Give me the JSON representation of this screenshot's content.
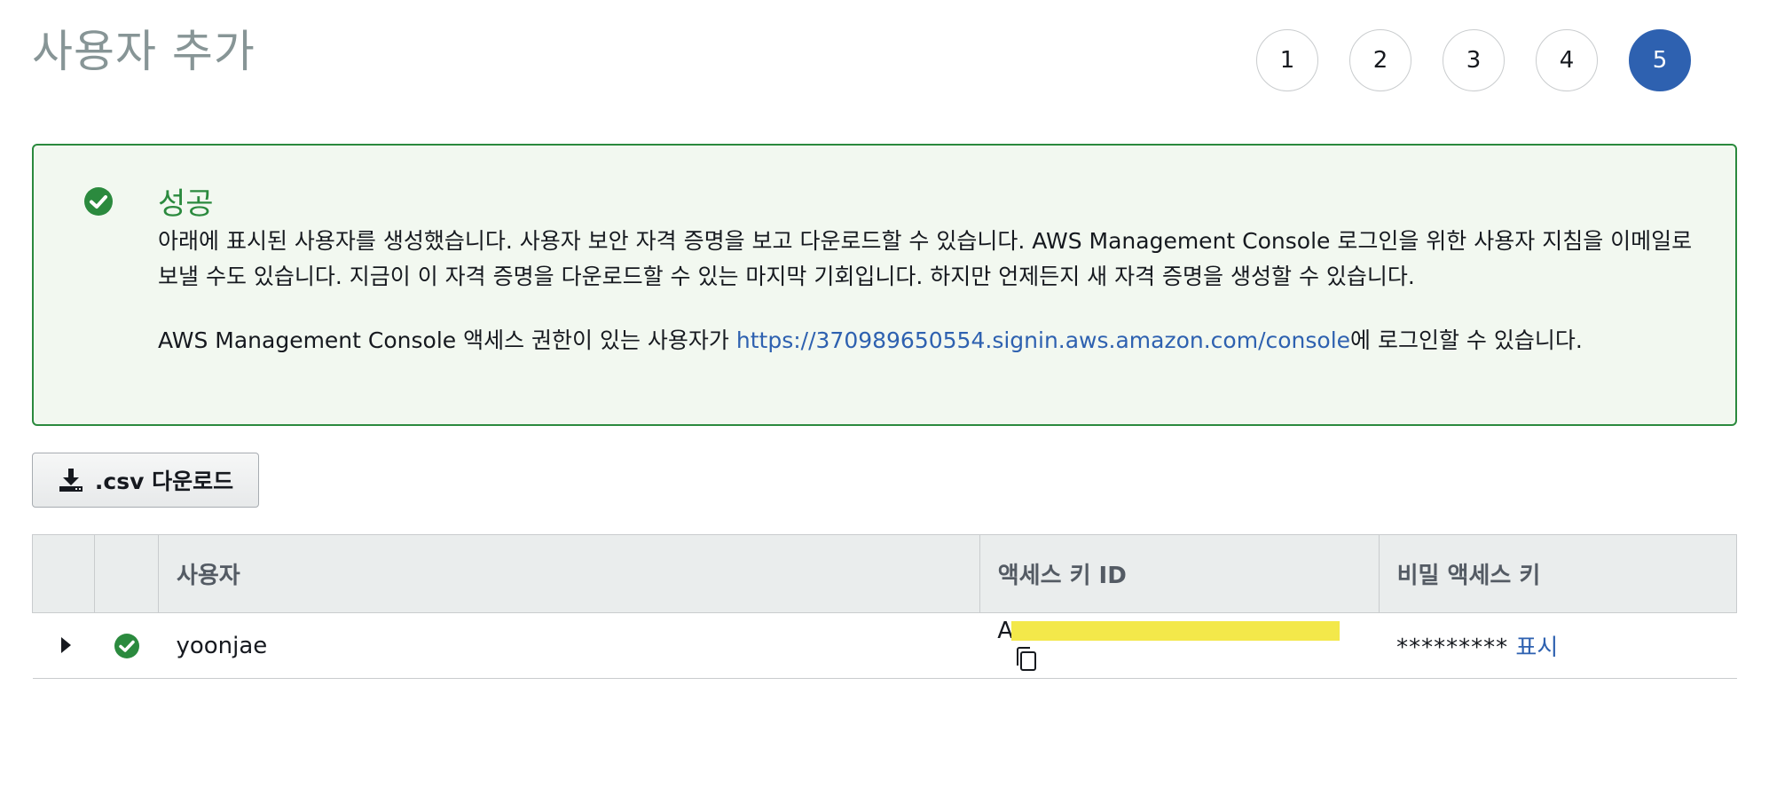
{
  "page": {
    "title": "사용자 추가"
  },
  "steps": [
    "1",
    "2",
    "3",
    "4",
    "5"
  ],
  "active_step": "5",
  "success": {
    "title": "성공",
    "description": "아래에 표시된 사용자를 생성했습니다. 사용자 보안 자격 증명을 보고 다운로드할 수 있습니다. AWS Management Console 로그인을 위한 사용자 지침을 이메일로 보낼 수도 있습니다. 지금이 이 자격 증명을 다운로드할 수 있는 마지막 기회입니다. 하지만 언제든지 새 자격 증명을 생성할 수 있습니다.",
    "login_prefix": "AWS Management Console 액세스 권한이 있는 사용자가 ",
    "login_url": "https://370989650554.signin.aws.amazon.com/console",
    "login_suffix": "에 로그인할 수 있습니다."
  },
  "toolbar": {
    "csv_label": ".csv 다운로드"
  },
  "table": {
    "headers": {
      "user": "사용자",
      "access_key": "액세스 키 ID",
      "secret_key": "비밀 액세스 키"
    },
    "rows": [
      {
        "user": "yoonjae",
        "access_key_prefix": "A",
        "secret_masked": "*********",
        "show_label": "표시"
      }
    ]
  },
  "colors": {
    "success": "#2b8a3e",
    "primary": "#2e61b0",
    "redaction": "#f3e84a"
  }
}
